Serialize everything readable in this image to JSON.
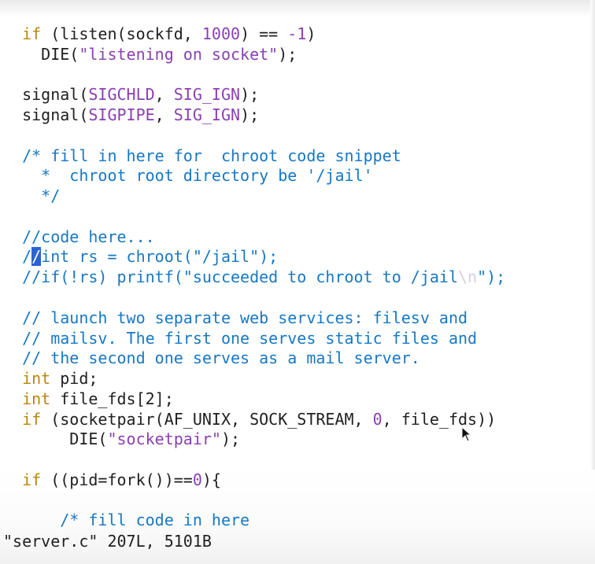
{
  "editor": {
    "lines": [
      [
        "  ",
        "if",
        " (listen(sockfd, ",
        "1000",
        ") == ",
        "-1",
        ")"
      ],
      [
        "    DIE(",
        "\"listening on socket\"",
        ");"
      ],
      [
        ""
      ],
      [
        "  signal(",
        "SIGCHLD",
        ", ",
        "SIG_IGN",
        ");"
      ],
      [
        "  signal(",
        "SIGPIPE",
        ", ",
        "SIG_IGN",
        ");"
      ],
      [
        ""
      ],
      [
        "  ",
        "/* fill in here for  chroot code snippet"
      ],
      [
        "  ",
        "  *  chroot root directory be '/jail'"
      ],
      [
        "  ",
        "  */"
      ],
      [
        ""
      ],
      [
        "  ",
        "//code here..."
      ],
      [
        "  ",
        "/",
        "/",
        "int rs = chroot(\"/jail\");"
      ],
      [
        "  ",
        "//if(!rs) printf(\"succeeded to chroot to /jail",
        "\\n",
        "\");"
      ],
      [
        ""
      ],
      [
        "  ",
        "// launch two separate web services: filesv and"
      ],
      [
        "  ",
        "// mailsv. The first one serves static files and"
      ],
      [
        "  ",
        "// the second one serves as a mail server."
      ],
      [
        "  ",
        "int",
        " pid;"
      ],
      [
        "  ",
        "int",
        " file_fds[2];"
      ],
      [
        "  ",
        "if",
        " (socketpair(AF_UNIX, SOCK_STREAM, ",
        "0",
        ", file_fds))"
      ],
      [
        "       DIE(",
        "\"socketpair\"",
        ");"
      ],
      [
        ""
      ],
      [
        "  ",
        "if",
        " ((pid=fork())==",
        "0",
        "){"
      ],
      [
        ""
      ],
      [
        "      ",
        "/* fill code in here"
      ]
    ],
    "status_line": "\"server.c\" 207L, 5101B"
  },
  "colors": {
    "keyword": "#b8860b",
    "string": "#8b3fb3",
    "comment": "#1778c4",
    "cursor": "#2a63d4",
    "text": "#1f1f1f"
  },
  "icons": {
    "pointer": "mouse-pointer-icon"
  }
}
